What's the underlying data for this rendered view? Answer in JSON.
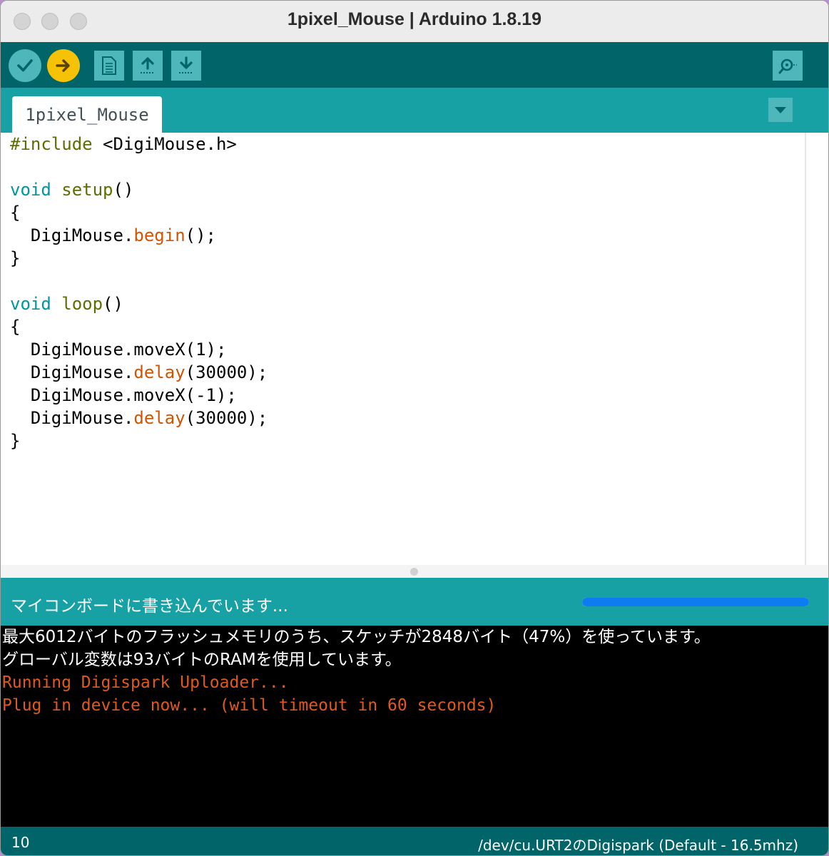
{
  "window": {
    "title": "1pixel_Mouse | Arduino 1.8.19"
  },
  "toolbar": {
    "buttons": [
      {
        "name": "verify",
        "icon": "check-icon",
        "color": "#4db7bb"
      },
      {
        "name": "upload",
        "icon": "arrow-right-icon",
        "color": "#f6c205"
      },
      {
        "name": "new",
        "icon": "new-file-icon"
      },
      {
        "name": "open",
        "icon": "open-arrow-up-icon"
      },
      {
        "name": "save",
        "icon": "save-arrow-down-icon"
      },
      {
        "name": "serial-monitor",
        "icon": "magnifier-icon"
      }
    ]
  },
  "tabs": [
    {
      "label": "1pixel_Mouse",
      "active": true
    }
  ],
  "editor": {
    "code_lines": [
      "#include <DigiMouse.h>",
      "",
      "void setup()",
      "{",
      "  DigiMouse.begin();",
      "}",
      "",
      "void loop()",
      "{",
      "  DigiMouse.moveX(1);",
      "  DigiMouse.delay(30000);",
      "  DigiMouse.moveX(-1);",
      "  DigiMouse.delay(30000);",
      "}"
    ]
  },
  "status": {
    "message": "マイコンボードに書き込んでいます...",
    "progress_fraction": 1.0
  },
  "console": {
    "lines": [
      {
        "text": "最大6012バイトのフラッシュメモリのうち、スケッチが2848バイト（47%）を使っています。",
        "style": "white"
      },
      {
        "text": "グローバル変数は93バイトのRAMを使用しています。",
        "style": "white"
      },
      {
        "text": "Running Digispark Uploader...",
        "style": "orange"
      },
      {
        "text": "Plug in device now... (will timeout in 60 seconds)",
        "style": "orange"
      }
    ]
  },
  "footer": {
    "line_number": "10",
    "board": "/dev/cu.URT2のDigispark (Default - 16.5mhz)"
  },
  "colors": {
    "toolbar_bg": "#006468",
    "tabstrip_bg": "#17a1a5",
    "console_orange": "#e05a1b",
    "progress_blue": "#0d7cf2"
  }
}
